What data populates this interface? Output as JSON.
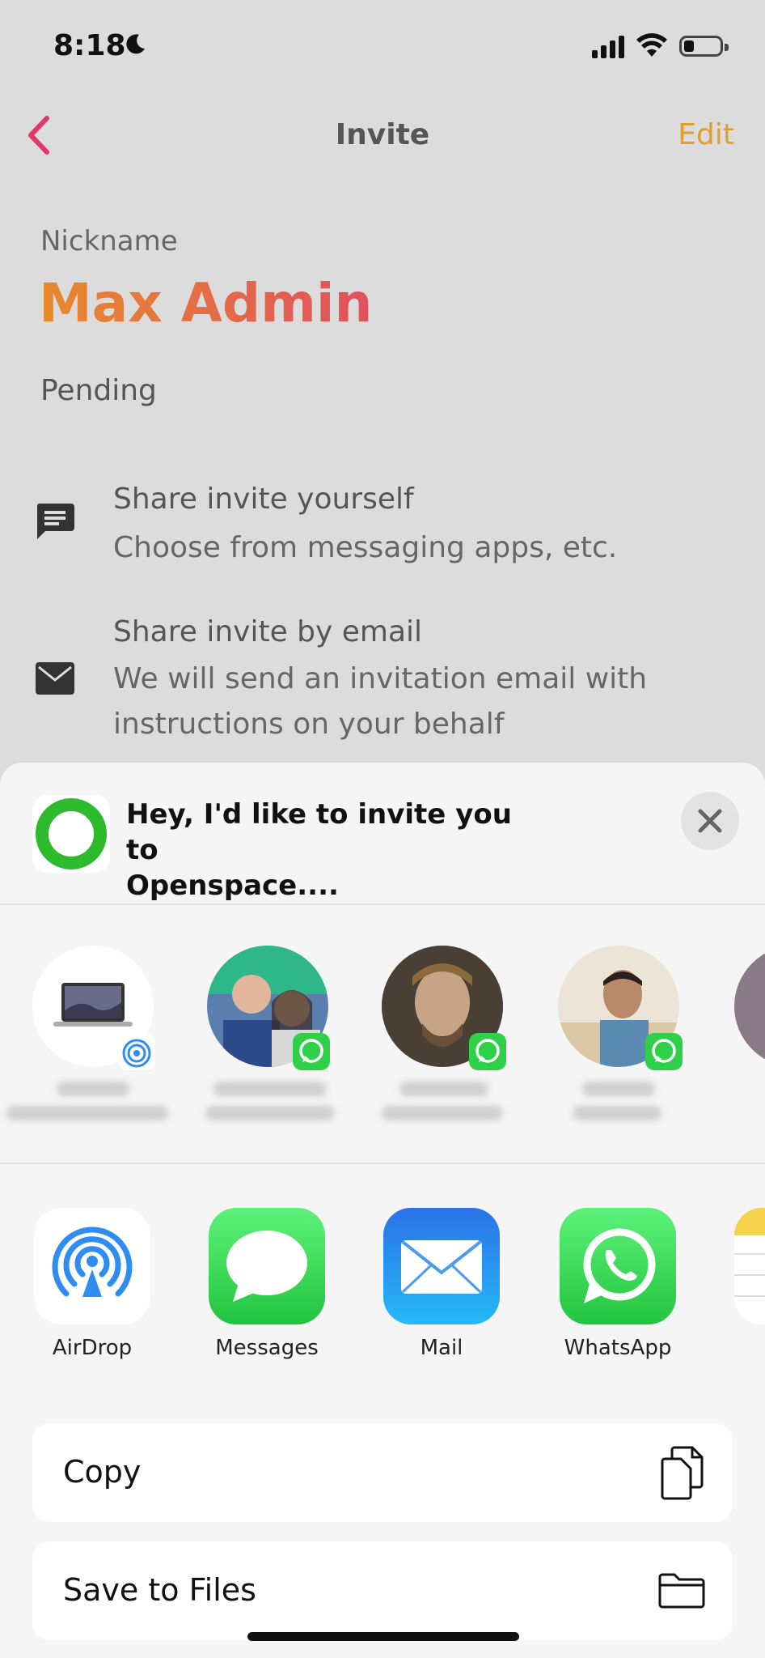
{
  "status_bar": {
    "time": "8:18"
  },
  "nav": {
    "title": "Invite",
    "edit_label": "Edit"
  },
  "profile": {
    "nickname_label": "Nickname",
    "nickname": "Max Admin",
    "status": "Pending"
  },
  "options": [
    {
      "title": "Share invite yourself",
      "description": "Choose from messaging apps, etc.",
      "icon": "message-icon"
    },
    {
      "title": "Share invite by email",
      "description_line1": "We will send an invitation email with",
      "description_line2": "instructions on your behalf",
      "icon": "mail-icon"
    }
  ],
  "share_sheet": {
    "preview_line1": "Hey, I'd like to invite you to",
    "preview_line2": "Openspace....",
    "apps": [
      {
        "label": "AirDrop",
        "icon": "airdrop-icon",
        "color": "#2f8cf0"
      },
      {
        "label": "Messages",
        "icon": "messages-icon",
        "color": "#2fcf4a"
      },
      {
        "label": "Mail",
        "icon": "mail-app-icon",
        "color": "#1e8cf5"
      },
      {
        "label": "WhatsApp",
        "icon": "whatsapp-icon",
        "color": "#2fcf4a"
      }
    ],
    "actions": [
      {
        "label": "Copy",
        "icon": "copy-icon"
      },
      {
        "label": "Save to Files",
        "icon": "folder-icon"
      }
    ]
  },
  "colors": {
    "accent_pink": "#e0386a",
    "accent_orange": "#e0a02f",
    "whatsapp_green": "#2fcf4a"
  }
}
